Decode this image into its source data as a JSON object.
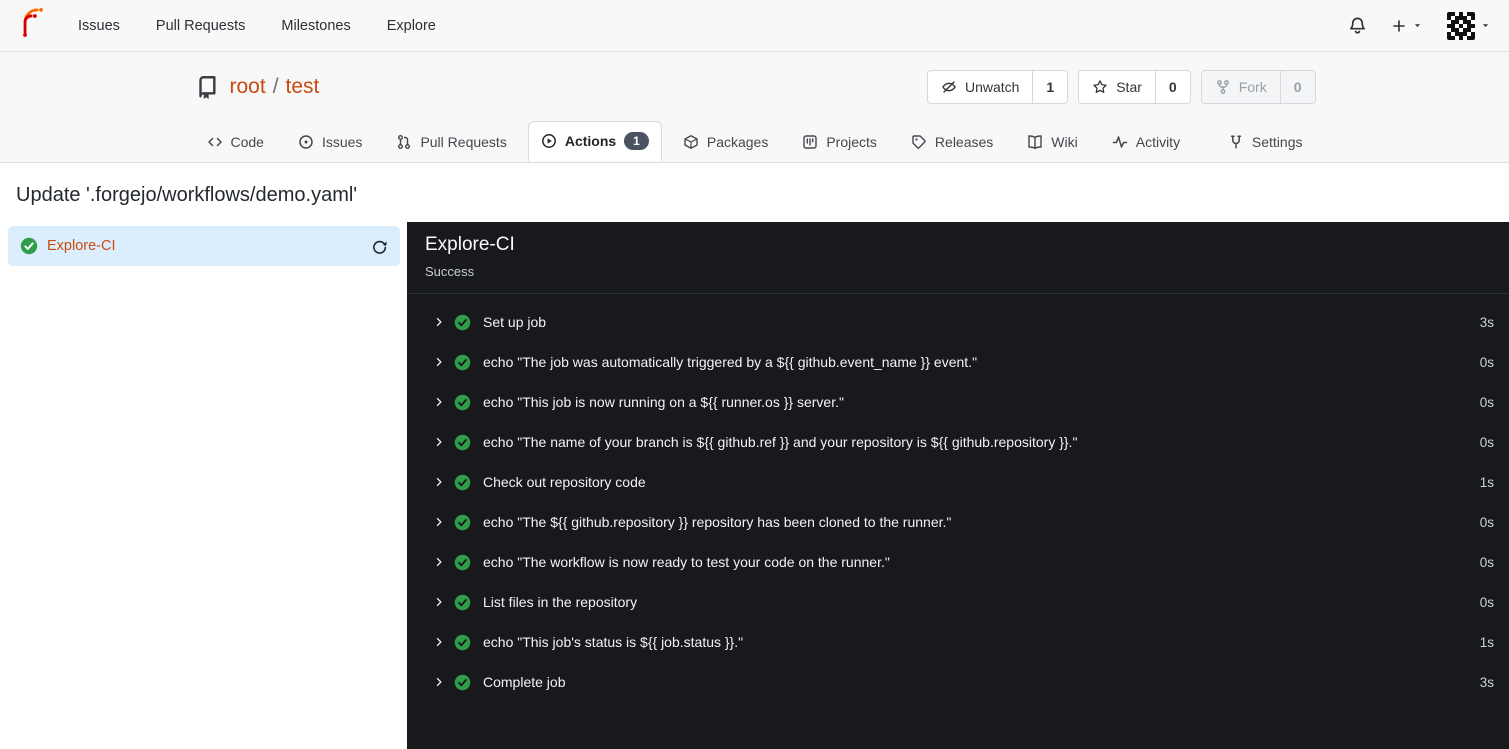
{
  "navbar": {
    "logo_icon": "forgejo-logo",
    "items": [
      {
        "label": "Issues"
      },
      {
        "label": "Pull Requests"
      },
      {
        "label": "Milestones"
      },
      {
        "label": "Explore"
      }
    ],
    "right": {
      "notifications_icon": "bell-icon",
      "create_icon": "plus-icon",
      "avatar_icon": "identicon-avatar"
    }
  },
  "repo_header": {
    "repo_icon": "repo-book-icon",
    "owner": "root",
    "separator": "/",
    "name": "test",
    "actions": [
      {
        "icon": "eye-slash-icon",
        "label": "Unwatch",
        "count": "1",
        "disabled": false
      },
      {
        "icon": "star-icon",
        "label": "Star",
        "count": "0",
        "disabled": false
      },
      {
        "icon": "fork-icon",
        "label": "Fork",
        "count": "0",
        "disabled": true
      }
    ]
  },
  "tabs": [
    {
      "icon": "code-icon",
      "label": "Code"
    },
    {
      "icon": "issue-circle-icon",
      "label": "Issues"
    },
    {
      "icon": "pull-request-icon",
      "label": "Pull Requests"
    },
    {
      "icon": "play-circle-icon",
      "label": "Actions",
      "badge": "1",
      "active": true
    },
    {
      "icon": "package-icon",
      "label": "Packages"
    },
    {
      "icon": "project-board-icon",
      "label": "Projects"
    },
    {
      "icon": "tag-icon",
      "label": "Releases"
    },
    {
      "icon": "book-icon",
      "label": "Wiki"
    },
    {
      "icon": "pulse-icon",
      "label": "Activity"
    },
    {
      "icon": "wrench-icon",
      "label": "Settings"
    }
  ],
  "page": {
    "title": "Update '.forgejo/workflows/demo.yaml'"
  },
  "sidebar": {
    "jobs": [
      {
        "status_icon": "check-circle-icon",
        "label": "Explore-CI",
        "rerun_icon": "refresh-icon",
        "selected": true
      }
    ]
  },
  "run_panel": {
    "job_title": "Explore-CI",
    "job_status": "Success",
    "steps": [
      {
        "name": "Set up job",
        "duration": "3s"
      },
      {
        "name": "echo \"The job was automatically triggered by a ${{ github.event_name }} event.\"",
        "duration": "0s"
      },
      {
        "name": "echo \"This job is now running on a ${{ runner.os }} server.\"",
        "duration": "0s"
      },
      {
        "name": "echo \"The name of your branch is ${{ github.ref }} and your repository is ${{ github.repository }}.\"",
        "duration": "0s"
      },
      {
        "name": "Check out repository code",
        "duration": "1s"
      },
      {
        "name": "echo \"The ${{ github.repository }} repository has been cloned to the runner.\"",
        "duration": "0s"
      },
      {
        "name": "echo \"The workflow is now ready to test your code on the runner.\"",
        "duration": "0s"
      },
      {
        "name": "List files in the repository",
        "duration": "0s"
      },
      {
        "name": "echo \"This job's status is ${{ job.status }}.\"",
        "duration": "1s"
      },
      {
        "name": "Complete job",
        "duration": "3s"
      }
    ]
  },
  "colors": {
    "brand_orange": "#cc4b0e",
    "success_green": "#2f9e49",
    "selected_job_bg": "#dbeefe",
    "panel_dark_bg": "#17191d",
    "header_bg": "#f8f8f8",
    "badge_bg": "#4a5362"
  }
}
